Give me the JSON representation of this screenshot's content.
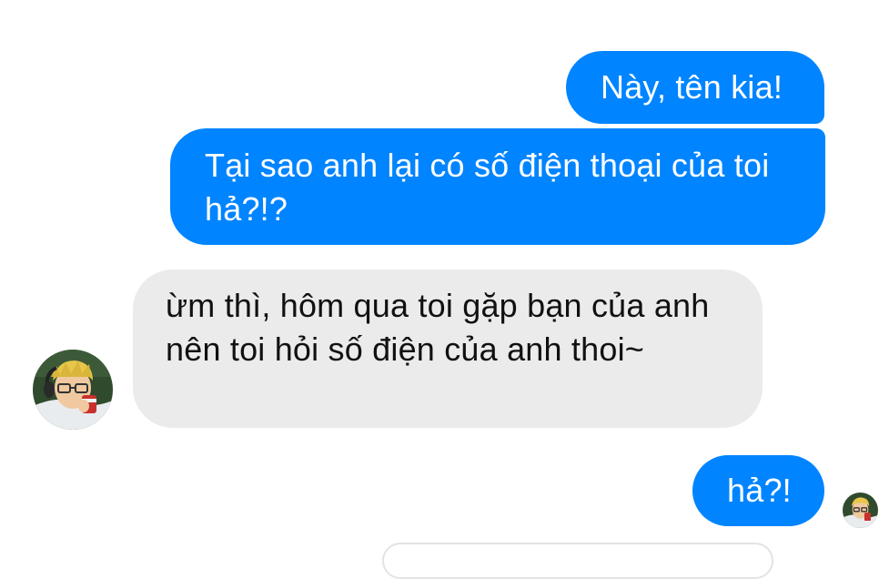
{
  "chat": {
    "messages": [
      {
        "sender": "me",
        "text": "Này, tên kia!"
      },
      {
        "sender": "me",
        "text": "Tại sao anh lại có số điện thoại của toi hả?!?"
      },
      {
        "sender": "other",
        "text": "ừm thì, hôm qua toi gặp bạn của anh nên toi hỏi số điện của anh thoi~"
      },
      {
        "sender": "me",
        "text": "hả?!"
      }
    ],
    "avatar_icon": "contact-avatar",
    "seen_icon": "seen-avatar"
  },
  "colors": {
    "sent_bubble": "#0084ff",
    "received_bubble": "#ebebeb",
    "background": "#ffffff"
  }
}
